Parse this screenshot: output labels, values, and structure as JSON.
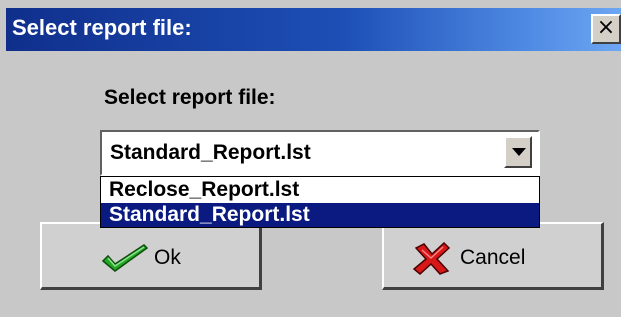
{
  "window": {
    "title": "Select report file:",
    "close_glyph": "×"
  },
  "prompt": {
    "label": "Select report file:"
  },
  "combo": {
    "selected_value": "Standard_Report.lst",
    "options": [
      {
        "label": "Reclose_Report.lst",
        "highlighted": false
      },
      {
        "label": "Standard_Report.lst",
        "highlighted": true
      }
    ]
  },
  "buttons": {
    "ok_label": "Ok",
    "ok_icon": "checkmark-icon",
    "cancel_label": "Cancel",
    "cancel_icon": "red-x-icon"
  },
  "colors": {
    "title_bar": "#1d4fb6",
    "selection": "#0a1a80",
    "face": "#c8c8c8"
  }
}
